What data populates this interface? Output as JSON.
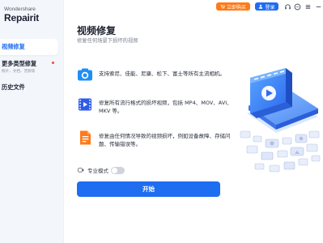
{
  "brand": {
    "sub": "Wondershare",
    "name": "Repairit"
  },
  "sidebar": {
    "items": [
      {
        "label": "视频修复",
        "active": true
      },
      {
        "label": "更多类型修复",
        "sub": "照片、文档、音频等",
        "badge_dot": true
      },
      {
        "label": "历史文件"
      }
    ]
  },
  "topbar": {
    "buy_label": "立即购买",
    "login_label": "登录",
    "icons": [
      "headset-icon",
      "feedback-icon",
      "menu-icon",
      "minimize-icon"
    ]
  },
  "main": {
    "title": "视频修复",
    "subtitle": "修复任何场景下损坏的视频",
    "features": [
      {
        "icon": "camera-icon",
        "text": "支持索尼、佳能、尼康、松下、富士等所有主流相机。"
      },
      {
        "icon": "film-icon",
        "text": "修复所有流行格式的损坏视频，包括 MP4、MOV、AVI、MKV 等。"
      },
      {
        "icon": "document-icon",
        "text": "修复由任何情况导致的视频损坏，例如设备故障、存储问题、传输错误等。"
      }
    ],
    "pro_mode_label": "专业模式",
    "pro_mode_enabled": false,
    "start_label": "开始"
  },
  "colors": {
    "accent": "#1f6df1",
    "orange": "#ff7a1a",
    "sidebar_bg": "#f3f6fb"
  }
}
